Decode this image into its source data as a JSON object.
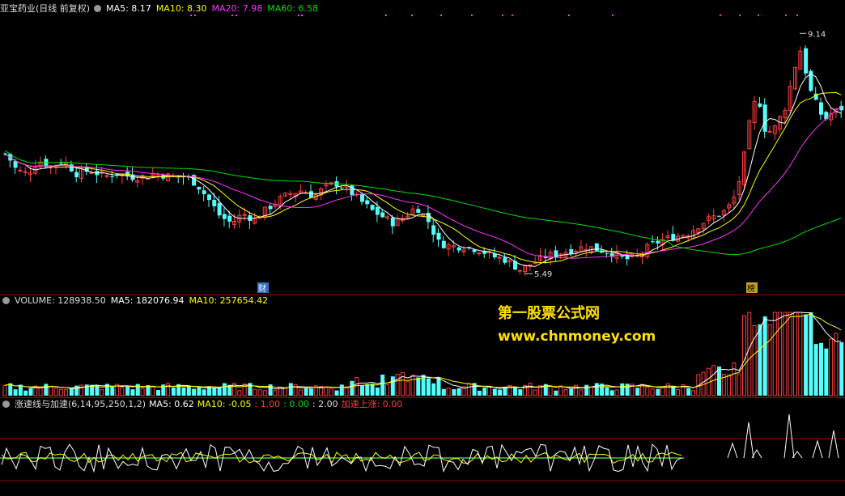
{
  "price_panel": {
    "title": "亚宝药业(日线 前复权)",
    "ma5": "MA5: 8.17",
    "ma10": "MA10: 8.30",
    "ma20": "MA20: 7.98",
    "ma60": "MA60: 6.58",
    "high_label": "9.14",
    "low_label": "5.49",
    "tag_fin": "财",
    "tag_list": "榜"
  },
  "volume_panel": {
    "title": "VOLUME: 128938.50",
    "ma5": "MA5: 182076.94",
    "ma10": "MA10: 257654.42"
  },
  "indicator_panel": {
    "title": "涨速线与加速(6,14,95,250,1,2)",
    "ma5": "MA5: 0.62",
    "ma10": "MA10: -0.05",
    "v1": ": 1.00",
    "v2": ": 0.00",
    "v3": ": 2.00",
    "accel": "加速上涨: 0.00"
  },
  "watermark": {
    "line1": "第一股票公式网",
    "line2": "www.chnmoney.com"
  },
  "colors": {
    "up": "#ff3b3b",
    "down": "#54ffff",
    "ma5": "#ffffff",
    "ma10": "#ffff00",
    "ma20": "#ff33ff",
    "ma60": "#00dd00",
    "grid": "#a00000"
  },
  "chart_data": [
    {
      "type": "candlestick",
      "title": "亚宝药业(日线 前复权)",
      "ylim": [
        5.2,
        9.4
      ],
      "annotations": [
        {
          "label": "9.14",
          "value": 9.14
        },
        {
          "label": "5.49",
          "value": 5.49
        }
      ],
      "series": [
        {
          "name": "MA5",
          "values": [
            8.17
          ]
        },
        {
          "name": "MA10",
          "values": [
            8.3
          ]
        },
        {
          "name": "MA20",
          "values": [
            7.98
          ]
        },
        {
          "name": "MA60",
          "values": [
            6.58
          ]
        }
      ]
    },
    {
      "type": "bar",
      "title": "VOLUME",
      "series": [
        {
          "name": "VOLUME",
          "values": [
            128938.5
          ]
        },
        {
          "name": "MA5",
          "values": [
            182076.94
          ]
        },
        {
          "name": "MA10",
          "values": [
            257654.42
          ]
        }
      ]
    },
    {
      "type": "line",
      "title": "涨速线与加速(6,14,95,250,1,2)",
      "series": [
        {
          "name": "MA5",
          "values": [
            0.62
          ]
        },
        {
          "name": "MA10",
          "values": [
            -0.05
          ]
        },
        {
          "name": "加速上涨",
          "values": [
            0.0
          ]
        }
      ]
    }
  ]
}
